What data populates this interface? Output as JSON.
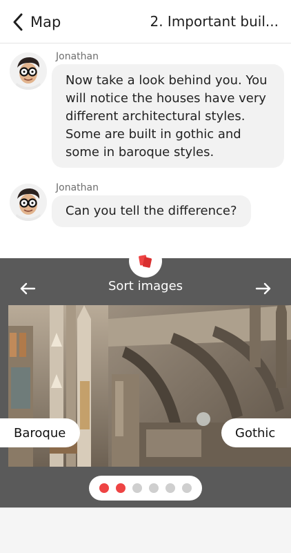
{
  "header": {
    "back_label": "Map",
    "title": "2. Important buil..."
  },
  "messages": [
    {
      "sender": "Jonathan",
      "text": "Now take a look behind you. You will notice the houses have very different architectural styles. Some are built in gothic and some in baroque styles."
    },
    {
      "sender": "Jonathan",
      "text": "Can you tell the difference?"
    }
  ],
  "sort": {
    "title": "Sort images",
    "left_option": "Baroque",
    "right_option": "Gothic",
    "pagination": {
      "total": 6,
      "active_count": 2
    }
  },
  "colors": {
    "accent": "#ee4444",
    "panel": "#5a5a5a",
    "bubble": "#f2f2f2"
  },
  "icons": {
    "back": "chevron-left-icon",
    "prev": "arrow-left-icon",
    "next": "arrow-right-icon",
    "sort_badge": "cards-icon"
  }
}
